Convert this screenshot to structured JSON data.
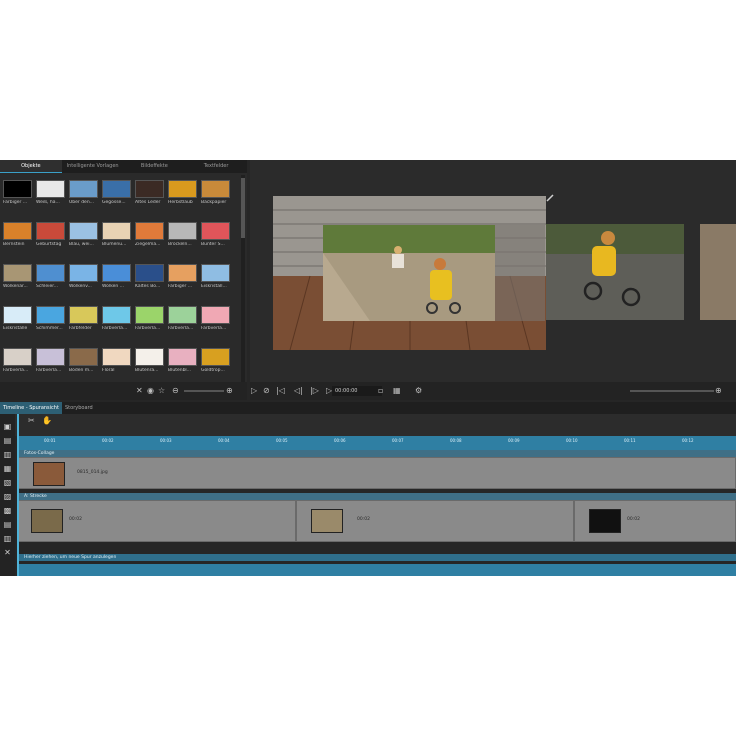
{
  "library": {
    "tabs": [
      "Objekte",
      "Intelligente Vorlagen",
      "Bildeffekte",
      "Textfelder"
    ],
    "items": [
      {
        "label": "Farbiger ...",
        "color": "#000000"
      },
      {
        "label": "Weiß, ha...",
        "color": "#e8e8e8"
      },
      {
        "label": "Über den...",
        "color": "#6a9cc9"
      },
      {
        "label": "Gegosse...",
        "color": "#3a6fa8"
      },
      {
        "label": "Altes Leder",
        "color": "#3b2a24"
      },
      {
        "label": "Herbstlaub",
        "color": "#d99a1e"
      },
      {
        "label": "Backpapier",
        "color": "#c88a3a"
      },
      {
        "label": "Bernstein",
        "color": "#d9812a"
      },
      {
        "label": "Geburtstag",
        "color": "#c94a3a"
      },
      {
        "label": "Blau, wei...",
        "color": "#9bc1e3"
      },
      {
        "label": "Blumenu...",
        "color": "#e8d2b4"
      },
      {
        "label": "Ziegelma...",
        "color": "#e07a3a"
      },
      {
        "label": "Bröckeln...",
        "color": "#b8b8b8"
      },
      {
        "label": "Bunter S...",
        "color": "#e0555a"
      },
      {
        "label": "Wolkenar...",
        "color": "#a89674"
      },
      {
        "label": "Schleier...",
        "color": "#4f8fd0"
      },
      {
        "label": "Wolkenv...",
        "color": "#7ab4e6"
      },
      {
        "label": "Wolken ...",
        "color": "#4a8ed8"
      },
      {
        "label": "Kaltes Bo...",
        "color": "#2a4f8a"
      },
      {
        "label": "Farbiger ...",
        "color": "#e6a060"
      },
      {
        "label": "Eiskristall...",
        "color": "#8fbde3"
      },
      {
        "label": "Eiskristalle",
        "color": "#d8ecf8"
      },
      {
        "label": "Schimmer...",
        "color": "#4aa6e0"
      },
      {
        "label": "Farbfelder",
        "color": "#d8c85a"
      },
      {
        "label": "Farbverla...",
        "color": "#6ec8e8"
      },
      {
        "label": "Farbverla...",
        "color": "#9bd46a"
      },
      {
        "label": "Farbverla...",
        "color": "#9cd29a"
      },
      {
        "label": "Farbverla...",
        "color": "#f0a8b4"
      },
      {
        "label": "Farbverla...",
        "color": "#d8d0c8"
      },
      {
        "label": "Farbverla...",
        "color": "#c8c0d8"
      },
      {
        "label": "Boden m...",
        "color": "#8a6a4a"
      },
      {
        "label": "Floral",
        "color": "#f0d8c0"
      },
      {
        "label": "Blütenra...",
        "color": "#f4f0ea"
      },
      {
        "label": "Blütenbl...",
        "color": "#e8b0c0"
      },
      {
        "label": "Goldtrop...",
        "color": "#d8a020"
      }
    ]
  },
  "transport": {
    "timecode": "00:00:00"
  },
  "timeline": {
    "tabs": [
      "Timeline - Spuransicht",
      "Storyboard"
    ],
    "ruler_ticks": [
      "00:01",
      "00:02",
      "00:03",
      "00:04",
      "00:05",
      "00:06",
      "00:07",
      "00:08",
      "00:09",
      "00:10",
      "00:11",
      "00:12"
    ],
    "track1": {
      "name": "Fotos-Collage",
      "clips": [
        {
          "label": "0815_014.jpg"
        }
      ]
    },
    "track2": {
      "name": "A: Strecke",
      "clips": [
        {
          "label": "00:02"
        },
        {
          "label": "00:02"
        },
        {
          "label": "00:02"
        }
      ]
    },
    "add_hint": "Hierher ziehen, um neue Spur anzulegen"
  },
  "colors": {
    "accent": "#3aa0c8",
    "ruler": "#2f7fa3",
    "clip": "#8a8a8a"
  }
}
